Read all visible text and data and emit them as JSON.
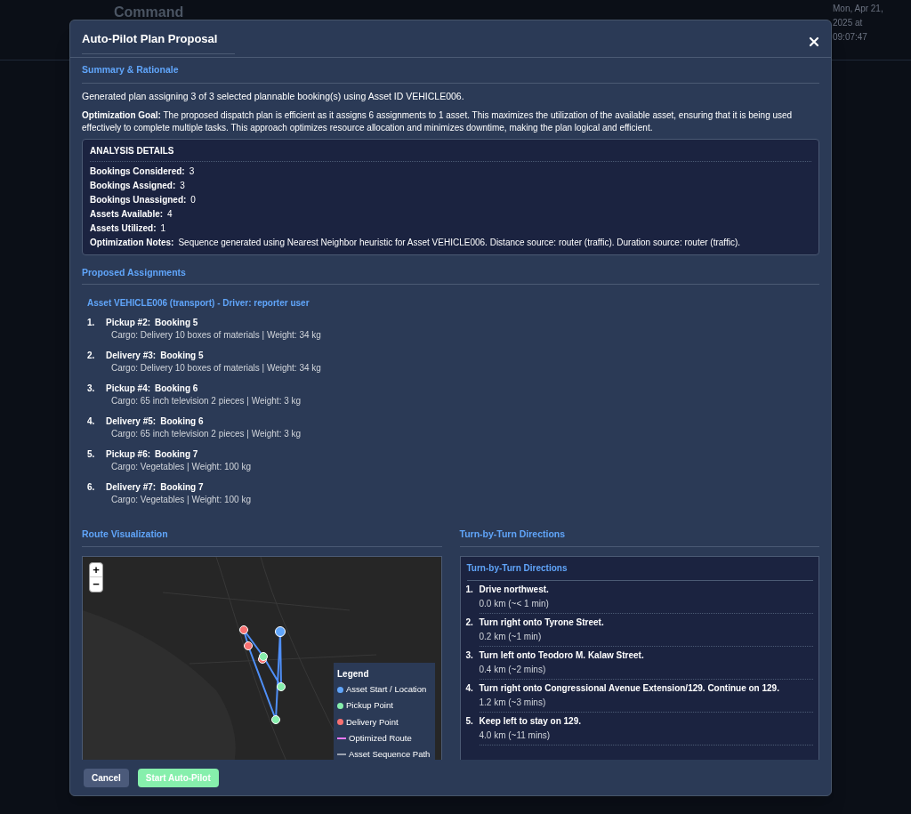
{
  "background": {
    "title": "Command",
    "datetime": "Mon, Apr 21, 2025 at 09:07:47"
  },
  "dialog": {
    "title": "Auto-Pilot Plan Proposal",
    "summary": {
      "heading": "Summary & Rationale",
      "text": "Generated plan assigning 3 of 3 selected plannable booking(s) using Asset ID VEHICLE006.",
      "goal": "**Optimization Goal:**  The proposed dispatch plan is efficient as it assigns 6 assignments to 1 asset. This maximizes the utilization of the available asset, ensuring that it is being used effectively to complete multiple tasks. This approach optimizes resource allocation and minimizes downtime, making the plan logical and efficient."
    },
    "analysis": {
      "heading": "ANALYSIS DETAILS",
      "rows": [
        {
          "label": "Bookings Considered:",
          "value": "3"
        },
        {
          "label": "Bookings Assigned:",
          "value": "3"
        },
        {
          "label": "Bookings Unassigned:",
          "value": "0"
        },
        {
          "label": "Assets Available:",
          "value": "4"
        },
        {
          "label": "Assets Utilized:",
          "value": "1"
        },
        {
          "label": "Optimization Notes:",
          "value": "Sequence generated using Nearest Neighbor heuristic for Asset VEHICLE006. Distance source: router (traffic). Duration source: router (traffic)."
        }
      ]
    },
    "assignments": {
      "heading": "Proposed Assignments",
      "asset": "Asset VEHICLE006 (transport) - Driver: reporter user",
      "items": [
        {
          "number": "1.",
          "label": "Pickup #2:",
          "booking": "Booking 5",
          "cargo": "Cargo: Delivery 10 boxes of materials | Weight: 34 kg"
        },
        {
          "number": "2.",
          "label": "Delivery #3:",
          "booking": "Booking 5",
          "cargo": "Cargo: Delivery 10 boxes of materials | Weight: 34 kg"
        },
        {
          "number": "3.",
          "label": "Pickup #4:",
          "booking": "Booking 6",
          "cargo": "Cargo: 65 inch television 2 pieces | Weight: 3 kg"
        },
        {
          "number": "4.",
          "label": "Delivery #5:",
          "booking": "Booking 6",
          "cargo": "Cargo: 65 inch television 2 pieces | Weight: 3 kg"
        },
        {
          "number": "5.",
          "label": "Pickup #6:",
          "booking": "Booking 7",
          "cargo": "Cargo: Vegetables | Weight: 100 kg"
        },
        {
          "number": "6.",
          "label": "Delivery #7:",
          "booking": "Booking 7",
          "cargo": "Cargo: Vegetables | Weight: 100 kg"
        }
      ]
    },
    "route": {
      "heading": "Route Visualization",
      "zoom_in": "+",
      "zoom_out": "−",
      "legend": {
        "title": "Legend",
        "items": [
          {
            "kind": "dot",
            "color": "#60a5fa",
            "label": "Asset Start / Location"
          },
          {
            "kind": "dot",
            "color": "#86efac",
            "label": "Pickup Point"
          },
          {
            "kind": "dot",
            "color": "#f87171",
            "label": "Delivery Point"
          },
          {
            "kind": "line",
            "color": "#e879f9",
            "label": "Optimized Route"
          },
          {
            "kind": "line",
            "color": "#9ca3af",
            "label": "Asset Sequence Path"
          }
        ]
      }
    },
    "directions": {
      "heading": "Turn-by-Turn Directions",
      "box_title": "Turn-by-Turn Directions",
      "steps": [
        {
          "number": "1.",
          "text": "Drive northwest.",
          "distance": "0.0 km (~< 1 min)"
        },
        {
          "number": "2.",
          "text": "Turn right onto Tyrone Street.",
          "distance": "0.2 km (~1 min)"
        },
        {
          "number": "3.",
          "text": "Turn left onto Teodoro M. Kalaw Street.",
          "distance": "0.4 km (~2 mins)"
        },
        {
          "number": "4.",
          "text": "Turn right onto Congressional Avenue Extension/129. Continue on 129.",
          "distance": "1.2 km (~3 mins)"
        },
        {
          "number": "5.",
          "text": "Keep left to stay on 129.",
          "distance": "4.0 km (~11 mins)"
        }
      ]
    },
    "buttons": [
      {
        "kind": "secondary",
        "label": "Cancel"
      },
      {
        "kind": "primary",
        "label": "Start Auto-Pilot"
      }
    ]
  }
}
